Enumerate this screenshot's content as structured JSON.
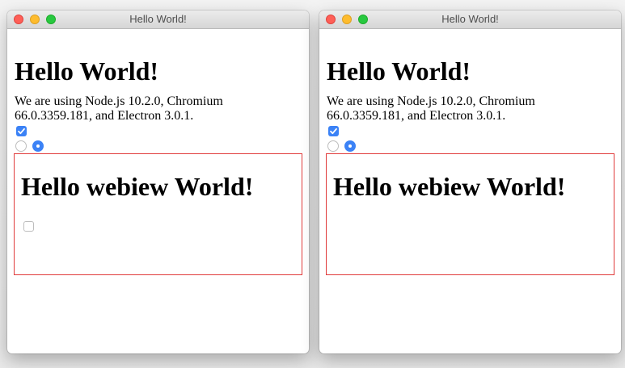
{
  "windows": [
    {
      "title": "Hello World!",
      "heading": "Hello World!",
      "paragraph": "We are using Node.js 10.2.0, Chromium 66.0.3359.181, and Electron 3.0.1.",
      "checkbox_checked": true,
      "radios": [
        false,
        true
      ],
      "webview": {
        "heading": "Hello webiew World!",
        "checkbox_visible": true,
        "checkbox_checked": false,
        "border_color": "#e03b3b"
      }
    },
    {
      "title": "Hello World!",
      "heading": "Hello World!",
      "paragraph": "We are using Node.js 10.2.0, Chromium 66.0.3359.181, and Electron 3.0.1.",
      "checkbox_checked": true,
      "radios": [
        false,
        true
      ],
      "webview": {
        "heading": "Hello webiew World!",
        "checkbox_visible": false,
        "border_color": "#e03b3b"
      }
    }
  ],
  "colors": {
    "accent": "#3b82f6",
    "close": "#fe5f57",
    "minimize": "#febc2e",
    "maximize": "#28c840"
  }
}
